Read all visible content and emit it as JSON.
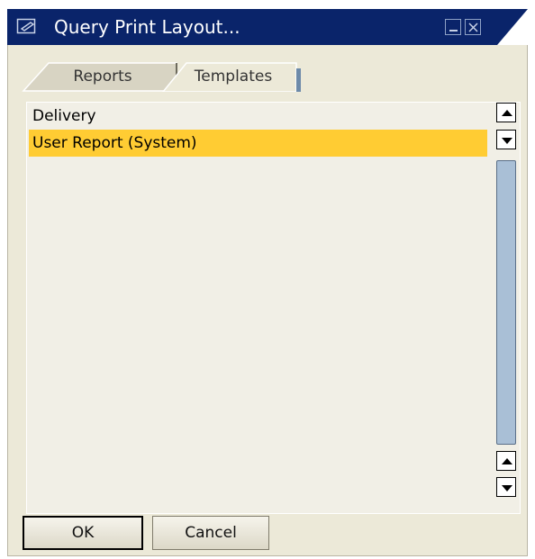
{
  "window": {
    "title": "Query Print Layout..."
  },
  "colors": {
    "titlebar": "#0a246a",
    "selection": "#ffcc33",
    "panel": "#ece9d8",
    "list_bg": "#f1efe6",
    "scroll_track": "#a9bfd6"
  },
  "tabs": [
    {
      "label": "Reports",
      "active": false
    },
    {
      "label": "Templates",
      "active": true
    }
  ],
  "list": {
    "items": [
      {
        "label": "Delivery",
        "selected": false
      },
      {
        "label": "User Report (System)",
        "selected": true
      }
    ]
  },
  "icons": {
    "title": "print-layout-icon",
    "minimize": "minimize-icon",
    "close": "close-icon",
    "scroll_up": "arrow-up-icon",
    "scroll_down": "arrow-down-icon"
  },
  "buttons": {
    "ok": "OK",
    "cancel": "Cancel"
  }
}
